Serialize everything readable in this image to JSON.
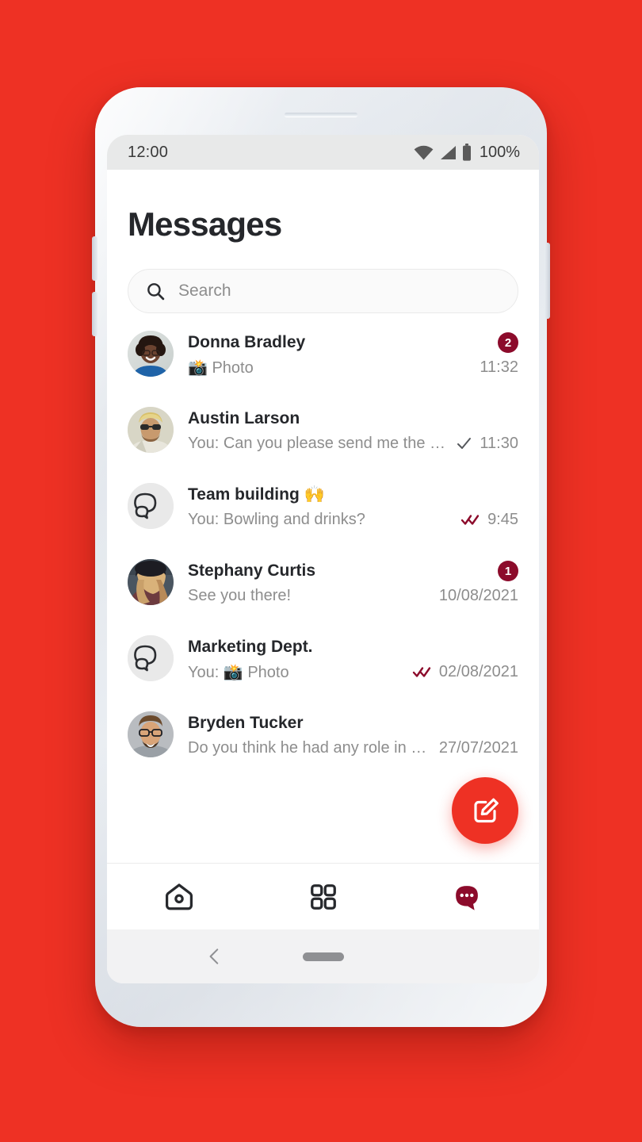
{
  "theme": {
    "background_red": "#EE3124",
    "accent_maroon": "#8C0B2B",
    "fab_red": "#EE3124",
    "text_primary": "#25272b",
    "text_secondary": "#8d8d8d"
  },
  "status_bar": {
    "time": "12:00",
    "battery_percent": "100%",
    "icons": [
      "wifi-icon",
      "cellular-signal-icon",
      "battery-icon"
    ]
  },
  "header": {
    "title": "Messages"
  },
  "search": {
    "placeholder": "Search",
    "value": "",
    "icon": "search-icon"
  },
  "conversations": [
    {
      "name": "Donna Bradley",
      "preview": "📸 Photo",
      "time": "11:32",
      "badge": "2",
      "receipt": "",
      "avatar_type": "photo",
      "avatar_id": "avatar-donna-bradley"
    },
    {
      "name": "Austin Larson",
      "preview": "You: Can you please send me the lates…",
      "time": "11:30",
      "badge": "",
      "receipt": "single-check",
      "avatar_type": "photo",
      "avatar_id": "avatar-austin-larson"
    },
    {
      "name": "Team building 🙌",
      "preview": "You: Bowling and drinks?",
      "time": "9:45",
      "badge": "",
      "receipt": "double-check",
      "avatar_type": "group",
      "avatar_id": "avatar-team-building"
    },
    {
      "name": "Stephany Curtis",
      "preview": "See you there!",
      "time": "10/08/2021",
      "badge": "1",
      "receipt": "",
      "avatar_type": "photo",
      "avatar_id": "avatar-stephany-curtis"
    },
    {
      "name": "Marketing Dept.",
      "preview": "You: 📸 Photo",
      "time": "02/08/2021",
      "badge": "",
      "receipt": "double-check",
      "avatar_type": "group",
      "avatar_id": "avatar-marketing-dept"
    },
    {
      "name": "Bryden Tucker",
      "preview": "Do you think he had any role in m…",
      "time": "27/07/2021",
      "badge": "",
      "receipt": "",
      "avatar_type": "photo",
      "avatar_id": "avatar-bryden-tucker"
    }
  ],
  "fab": {
    "icon": "compose-icon",
    "label": ""
  },
  "tab_bar": {
    "items": [
      {
        "icon": "home-icon",
        "name": "tab-home",
        "active": false
      },
      {
        "icon": "grid-apps-icon",
        "name": "tab-apps",
        "active": false
      },
      {
        "icon": "chat-bubble-icon",
        "name": "tab-messages",
        "active": true
      }
    ]
  },
  "android_nav": {
    "back_icon": "chevron-left-icon",
    "home_pill": "home-pill-indicator"
  }
}
